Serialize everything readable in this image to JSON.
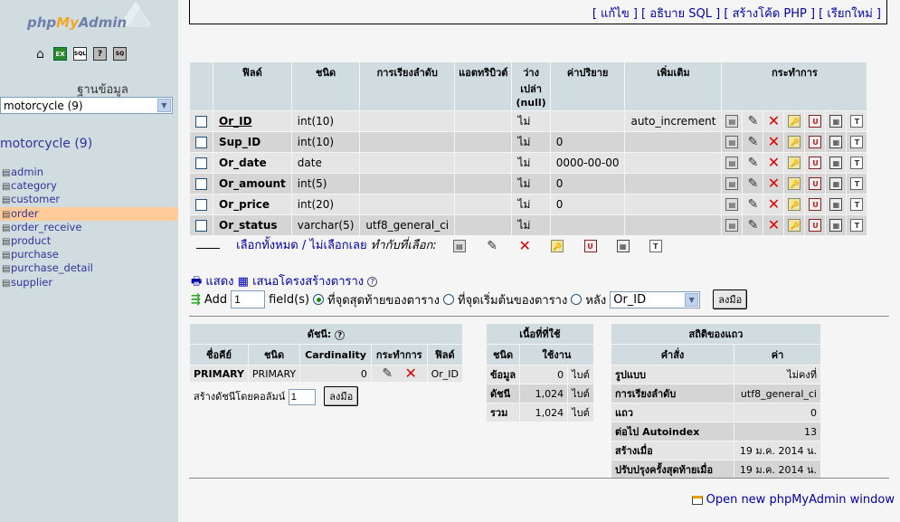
{
  "sidebar": {
    "logo_php": "php",
    "logo_my": "My",
    "logo_admin": "Admin",
    "db_label": "ฐานข้อมูล",
    "db_select": "motorcycle (9)",
    "db_title": "motorcycle (9)",
    "tables": [
      "admin",
      "category",
      "customer",
      "order",
      "order_receive",
      "product",
      "purchase",
      "purchase_detail",
      "supplier"
    ],
    "selected_table": "order"
  },
  "top_links": "[ แก้ไข ] [ อธิบาย SQL ] [ สร้างโค้ด PHP ] [ เรียกใหม่ ]",
  "fields_table": {
    "headers": [
      "ฟิลด์",
      "ชนิด",
      "การเรียงลำดับ",
      "แอตทริบิวต์",
      "ว่าง\nเปล่า\n(null)",
      "ค่าปริยาย",
      "เพิ่มเติม",
      "กระทำการ"
    ],
    "rows": [
      {
        "field": "Or_ID",
        "type": "int(10)",
        "collation": "",
        "attributes": "",
        "null": "ไม่",
        "default": "",
        "extra": "auto_increment"
      },
      {
        "field": "Sup_ID",
        "type": "int(10)",
        "collation": "",
        "attributes": "",
        "null": "ไม่",
        "default": "0",
        "extra": ""
      },
      {
        "field": "Or_date",
        "type": "date",
        "collation": "",
        "attributes": "",
        "null": "ไม่",
        "default": "0000-00-00",
        "extra": ""
      },
      {
        "field": "Or_amount",
        "type": "int(5)",
        "collation": "",
        "attributes": "",
        "null": "ไม่",
        "default": "0",
        "extra": ""
      },
      {
        "field": "Or_price",
        "type": "int(20)",
        "collation": "",
        "attributes": "",
        "null": "ไม่",
        "default": "0",
        "extra": ""
      },
      {
        "field": "Or_status",
        "type": "varchar(5)",
        "collation": "utf8_general_ci",
        "attributes": "",
        "null": "ไม่",
        "default": "",
        "extra": ""
      }
    ]
  },
  "select_all": {
    "all": "เลือกทั้งหมด",
    "sep": " / ",
    "none": "ไม่เลือกเลย",
    "with": "ทำกับที่เลือก:"
  },
  "print_row": {
    "print": "แสดง",
    "propose": "เสนอโครงสร้างตาราง"
  },
  "add_row": {
    "add": "Add",
    "count": "1",
    "fields": "field(s)",
    "at_end": "ที่จุดสุดท้ายของตาราง",
    "at_start": "ที่จุดเริ่มต้นของตาราง",
    "after": "หลัง",
    "after_field": "Or_ID",
    "go": "ลงมือ"
  },
  "indexes": {
    "title": "ดัชนี:",
    "headers": [
      "ชื่อคีย์",
      "ชนิด",
      "Cardinality",
      "กระทำการ",
      "ฟิลด์"
    ],
    "rows": [
      {
        "key": "PRIMARY",
        "type": "PRIMARY",
        "cardinality": "0",
        "field": "Or_ID"
      }
    ],
    "create_label": "สร้างดัชนีโดยคอลัมน์",
    "create_count": "1",
    "go": "ลงมือ"
  },
  "space": {
    "title": "เนื้อที่ที่ใช้",
    "headers": [
      "ชนิด",
      "ใช้งาน"
    ],
    "rows": [
      {
        "type": "ข้อมูล",
        "value": "0",
        "unit": "ไบต์"
      },
      {
        "type": "ดัชนี",
        "value": "1,024",
        "unit": "ไบต์"
      },
      {
        "type": "รวม",
        "value": "1,024",
        "unit": "ไบต์"
      }
    ]
  },
  "stats": {
    "title": "สถิติของแถว",
    "headers": [
      "คำสั่ง",
      "ค่า"
    ],
    "rows": [
      {
        "label": "รูปแบบ",
        "value": "ไม่คงที่"
      },
      {
        "label": "การเรียงลำดับ",
        "value": "utf8_general_ci"
      },
      {
        "label": "แถว",
        "value": "0"
      },
      {
        "label": "ต่อไป Autoindex",
        "value": "13"
      },
      {
        "label": "สร้างเมื่อ",
        "value": "19 ม.ค. 2014 น."
      },
      {
        "label": "ปรับปรุงครั้งสุดท้ายเมื่อ",
        "value": "19 ม.ค. 2014 น."
      }
    ]
  },
  "bottom_link": "Open new phpMyAdmin window"
}
